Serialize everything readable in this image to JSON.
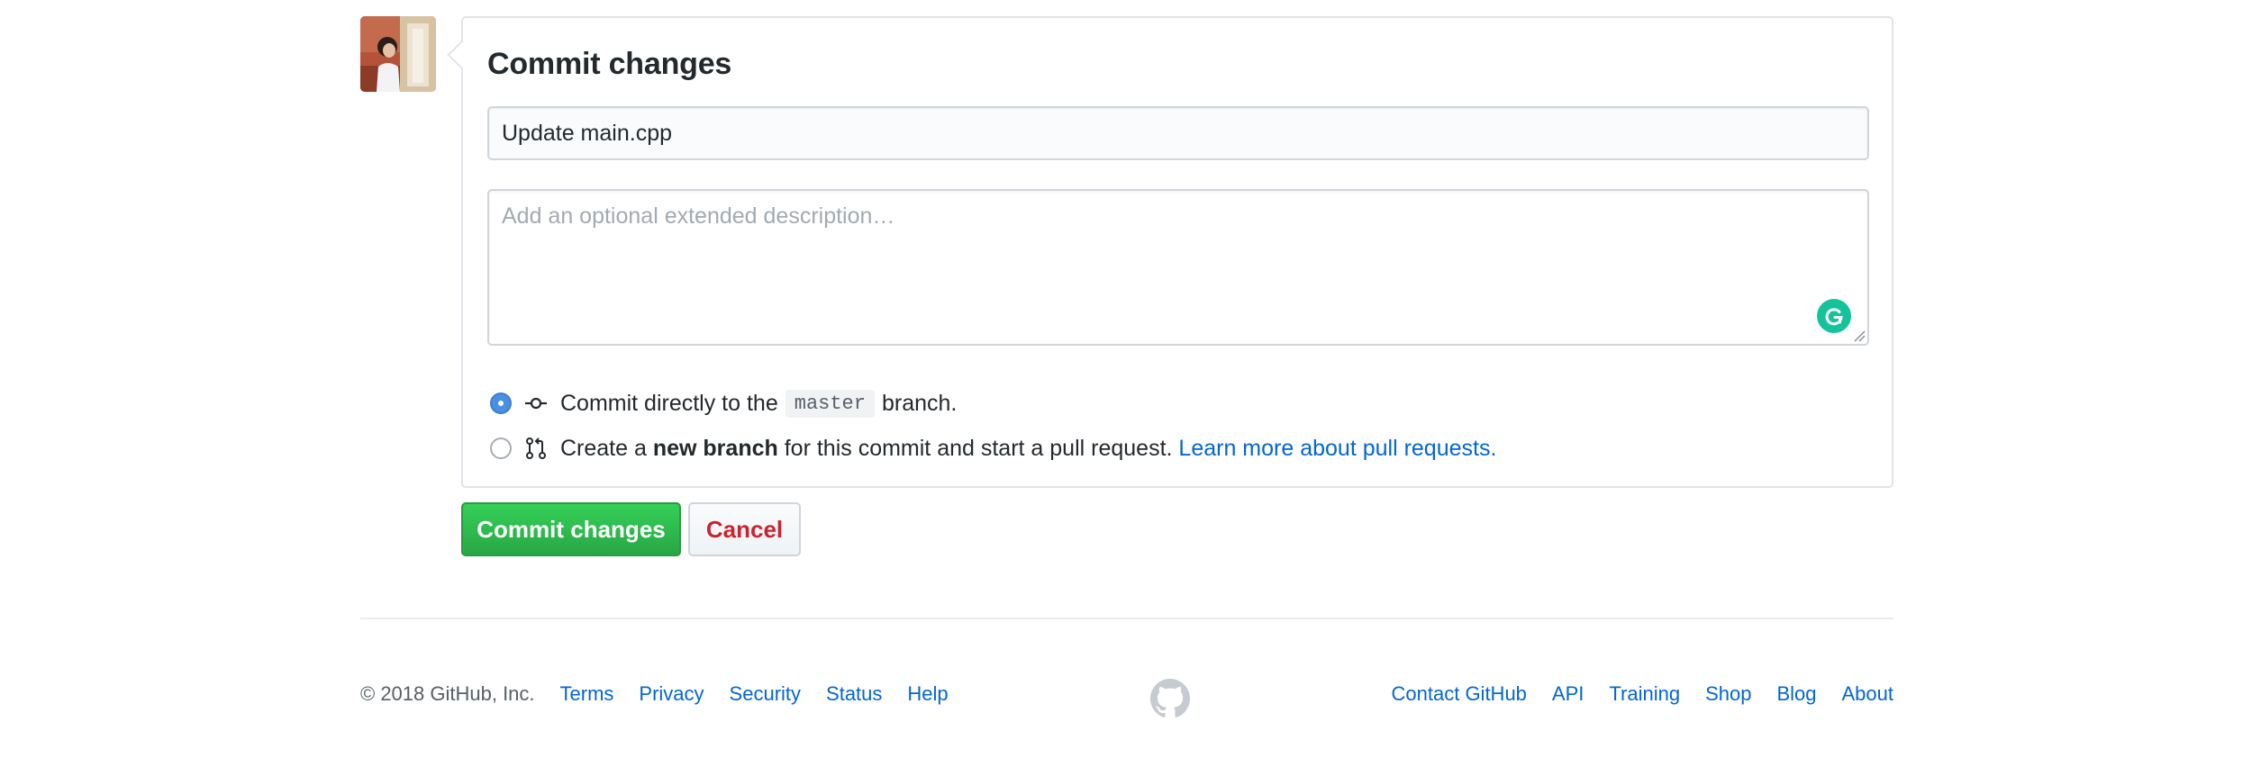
{
  "commit": {
    "heading": "Commit changes",
    "summary_value": "Update main.cpp",
    "description_placeholder": "Add an optional extended description…",
    "option_direct": {
      "text_before": "Commit directly to the",
      "branch_name": "master",
      "text_after": "branch."
    },
    "option_new_branch": {
      "text_before": "Create a",
      "bold_text": "new branch",
      "text_after": "for this commit and start a pull request.",
      "link_text": "Learn more about pull requests."
    },
    "selected_option": "direct"
  },
  "buttons": {
    "commit_label": "Commit changes",
    "cancel_label": "Cancel"
  },
  "footer": {
    "copyright": "© 2018 GitHub, Inc.",
    "left_links": [
      "Terms",
      "Privacy",
      "Security",
      "Status",
      "Help"
    ],
    "right_links": [
      "Contact GitHub",
      "API",
      "Training",
      "Shop",
      "Blog",
      "About"
    ]
  },
  "icons": {
    "avatar": "user-avatar",
    "commit": "git-commit-icon",
    "pull_request": "git-pull-request-icon",
    "grammarly": "grammarly-icon",
    "footer_logo": "github-mark-icon"
  },
  "colors": {
    "primary_button": "#28a745",
    "cancel_text": "#cb2431",
    "link": "#0366d6",
    "radio_checked": "#4a90e2",
    "grammarly": "#15c39a"
  }
}
